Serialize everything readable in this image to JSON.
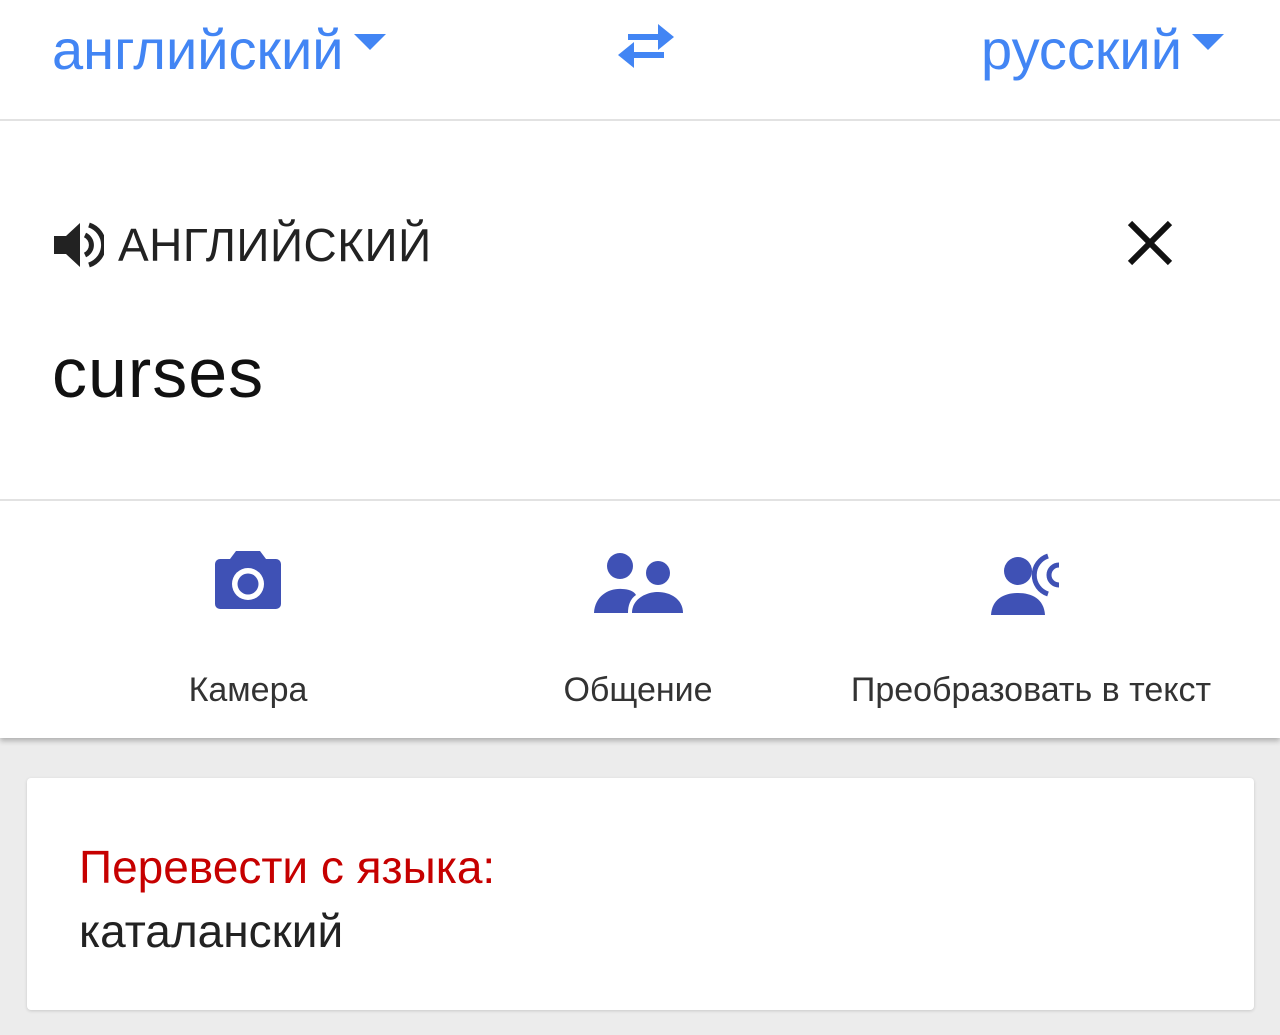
{
  "colors": {
    "accent": "#4285f4",
    "tool_icon": "#3f51b5",
    "suggestion_title": "#c60000"
  },
  "lang_bar": {
    "source_language": "английский",
    "target_language": "русский",
    "swap_icon": "swap-arrows-icon"
  },
  "input": {
    "detected_language_label": "АНГЛИЙСКИЙ",
    "speaker_icon": "speaker-icon",
    "clear_icon": "close-icon",
    "text": "curses"
  },
  "tools": [
    {
      "label": "Камера",
      "icon": "camera-icon"
    },
    {
      "label": "Общение",
      "icon": "people-icon"
    },
    {
      "label": "Преобразовать в текст",
      "icon": "voice-transcribe-icon"
    }
  ],
  "suggestion": {
    "title": "Перевести с языка:",
    "language": "каталанский"
  }
}
